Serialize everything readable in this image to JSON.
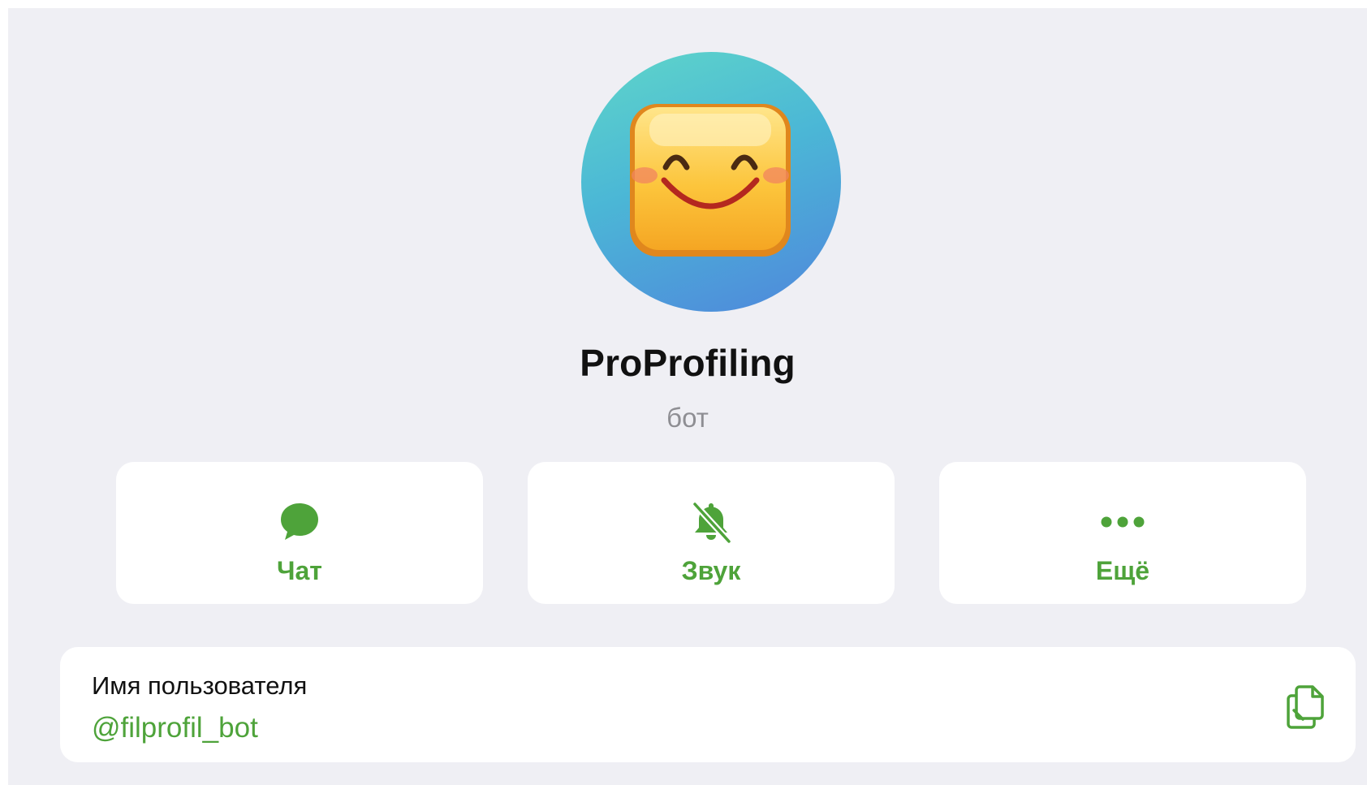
{
  "profile": {
    "name": "ProProfiling",
    "subtitle": "бот",
    "avatar_icon": "smiling-face-emoji"
  },
  "actions": [
    {
      "label": "Чат",
      "icon": "chat-bubble-icon"
    },
    {
      "label": "Звук",
      "icon": "bell-muted-icon"
    },
    {
      "label": "Ещё",
      "icon": "more-dots-icon"
    }
  ],
  "username_card": {
    "label": "Имя пользователя",
    "value": "@filprofil_bot",
    "copy_icon": "copy-icon"
  },
  "colors": {
    "accent": "#4ea33a",
    "background": "#efeff4",
    "card": "#ffffff",
    "subtitle": "#8e8e93"
  }
}
